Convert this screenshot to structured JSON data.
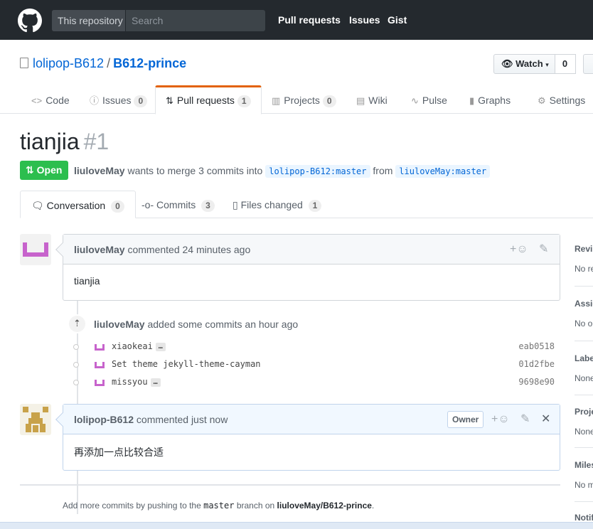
{
  "header": {
    "search_scope": "This repository",
    "search_placeholder": "Search",
    "nav": [
      "Pull requests",
      "Issues",
      "Gist"
    ]
  },
  "repo": {
    "owner": "lolipop-B612",
    "separator": "/",
    "name": "B612-prince",
    "watch_label": "Watch",
    "watch_count": "0"
  },
  "reponav": {
    "code": "Code",
    "issues": "Issues",
    "issues_count": "0",
    "pulls": "Pull requests",
    "pulls_count": "1",
    "projects": "Projects",
    "projects_count": "0",
    "wiki": "Wiki",
    "pulse": "Pulse",
    "graphs": "Graphs",
    "settings": "Settings"
  },
  "pr": {
    "title": "tianjia",
    "number": "#1",
    "state": "Open",
    "author": "liuloveMay",
    "meta_text": "wants to merge 3 commits into",
    "base_ref": "lolipop-B612:master",
    "from_text": "from",
    "head_ref": "liuloveMay:master"
  },
  "tabs": {
    "conversation": "Conversation",
    "conversation_count": "0",
    "commits": "Commits",
    "commits_count": "3",
    "files": "Files changed",
    "files_count": "1"
  },
  "comment1": {
    "author": "liuloveMay",
    "action": "commented 24 minutes ago",
    "body": "tianjia"
  },
  "commits_event": {
    "author": "liuloveMay",
    "text": "added some commits an hour ago",
    "items": [
      {
        "message": "xiaokeai",
        "sha": "eab0518",
        "has_ellipsis": true
      },
      {
        "message": "Set theme jekyll-theme-cayman",
        "sha": "01d2fbe",
        "has_ellipsis": false
      },
      {
        "message": "missyou",
        "sha": "9698e90",
        "has_ellipsis": true
      }
    ],
    "ellipsis": "…"
  },
  "comment2": {
    "author": "lolipop-B612",
    "action": "commented just now",
    "badge": "Owner",
    "body": "再添加一点比较合适"
  },
  "hint": {
    "prefix": "Add more commits by pushing to the",
    "branch": "master",
    "middle": "branch on",
    "repo": "liuloveMay/B612-prince",
    "suffix": "."
  },
  "sidebar": [
    {
      "heading": "Revi",
      "value": "No re"
    },
    {
      "heading": "Assig",
      "value": "No o"
    },
    {
      "heading": "Labe",
      "value": "None"
    },
    {
      "heading": "Proje",
      "value": "None"
    },
    {
      "heading": "Miles",
      "value": "No m"
    },
    {
      "heading": "Notif",
      "value": ""
    }
  ],
  "colors": {
    "header_bg": "#24292e",
    "link": "#0366d6",
    "open_green": "#2cbe4e",
    "tab_accent": "#e36209",
    "avatar_purple": "#c763cc",
    "avatar_gold": "#c8a24a"
  }
}
